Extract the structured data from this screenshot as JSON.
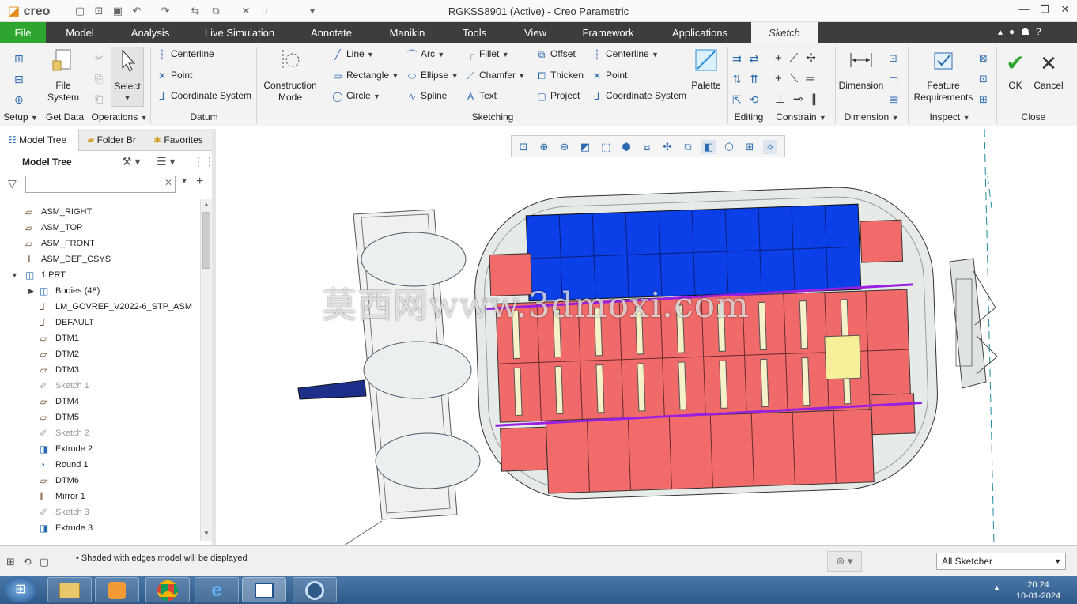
{
  "app": {
    "logo": "creo",
    "title": "RGKSS8901 (Active) - Creo Parametric"
  },
  "menubar": {
    "file": "File",
    "tabs": [
      "Model",
      "Analysis",
      "Live Simulation",
      "Annotate",
      "Manikin",
      "Tools",
      "View",
      "Framework",
      "Applications"
    ],
    "active_tab": "Sketch"
  },
  "ribbon": {
    "groups": {
      "setup": "Setup",
      "get_data": "Get Data",
      "operations": "Operations",
      "datum": "Datum",
      "sketching": "Sketching",
      "editing": "Editing",
      "constrain": "Constrain",
      "dimension": "Dimension",
      "inspect": "Inspect",
      "close": "Close"
    },
    "file_system": "File\nSystem",
    "select": "Select",
    "datum": {
      "centerline": "Centerline",
      "point": "Point",
      "coordinate_system": "Coordinate System"
    },
    "construction_mode": "Construction\nMode",
    "sketching": {
      "line": "Line",
      "rectangle": "Rectangle",
      "circle": "Circle",
      "arc": "Arc",
      "ellipse": "Ellipse",
      "spline": "Spline",
      "fillet": "Fillet",
      "chamfer": "Chamfer",
      "text": "Text",
      "offset": "Offset",
      "thicken": "Thicken",
      "project": "Project",
      "centerline": "Centerline",
      "point": "Point",
      "coordinate_system": "Coordinate System",
      "palette": "Palette"
    },
    "dimension": "Dimension",
    "feature_requirements": "Feature\nRequirements",
    "ok": "OK",
    "cancel": "Cancel"
  },
  "left_panel": {
    "tabs": [
      "Model Tree",
      "Folder Br",
      "Favorites"
    ],
    "header": "Model Tree",
    "search_value": "",
    "items": [
      {
        "label": "ASM_RIGHT",
        "icon": "datum-plane-icon"
      },
      {
        "label": "ASM_TOP",
        "icon": "datum-plane-icon"
      },
      {
        "label": "ASM_FRONT",
        "icon": "datum-plane-icon"
      },
      {
        "label": "ASM_DEF_CSYS",
        "icon": "csys-icon"
      },
      {
        "label": "1.PRT",
        "icon": "part-icon"
      },
      {
        "label": "Bodies (48)",
        "icon": "bodies-icon"
      },
      {
        "label": "LM_GOVREF_V2022-6_STP_ASM",
        "icon": "csys-icon"
      },
      {
        "label": "DEFAULT",
        "icon": "csys-icon"
      },
      {
        "label": "DTM1",
        "icon": "datum-plane-icon"
      },
      {
        "label": "DTM2",
        "icon": "datum-plane-icon"
      },
      {
        "label": "DTM3",
        "icon": "datum-plane-icon"
      },
      {
        "label": "Sketch 1",
        "icon": "sketch-icon"
      },
      {
        "label": "DTM4",
        "icon": "datum-plane-icon"
      },
      {
        "label": "DTM5",
        "icon": "datum-plane-icon"
      },
      {
        "label": "Sketch 2",
        "icon": "sketch-icon"
      },
      {
        "label": "Extrude 2",
        "icon": "extrude-icon"
      },
      {
        "label": "Round 1",
        "icon": "round-icon"
      },
      {
        "label": "DTM6",
        "icon": "datum-plane-icon"
      },
      {
        "label": "Mirror 1",
        "icon": "mirror-icon"
      },
      {
        "label": "Sketch 3",
        "icon": "sketch-icon"
      },
      {
        "label": "Extrude 3",
        "icon": "extrude-icon"
      }
    ]
  },
  "viewport": {
    "watermark": "莫西网www.3dmoxi.com"
  },
  "status": {
    "message": "Shaded with edges model will be displayed",
    "filter": "All Sketcher"
  },
  "taskbar": {
    "time": "20:24",
    "date": "10-01-2024"
  },
  "colors": {
    "file_tab": "#2ea52e",
    "menubar": "#3d3d3d",
    "solar_blue": "#0b3fe8",
    "module_red": "#f26b6b",
    "hull": "#e6ebe8"
  }
}
